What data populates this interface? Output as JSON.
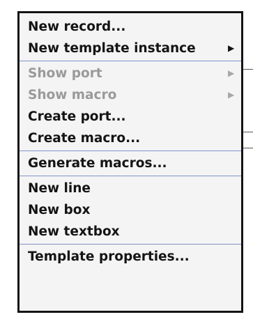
{
  "menu": {
    "items": [
      {
        "label": "New record...",
        "enabled": true
      },
      {
        "label": "New template instance",
        "enabled": true,
        "submenu": true,
        "arrow_icon": "submenu-arrow-icon"
      },
      {
        "label": "Show port",
        "enabled": false,
        "submenu": true,
        "arrow_icon": "submenu-arrow-icon"
      },
      {
        "label": "Show macro",
        "enabled": false,
        "submenu": true,
        "arrow_icon": "submenu-arrow-icon"
      },
      {
        "label": "Create port...",
        "enabled": true
      },
      {
        "label": "Create macro...",
        "enabled": true
      },
      {
        "label": "Generate macros...",
        "enabled": true
      },
      {
        "label": "New line",
        "enabled": true
      },
      {
        "label": "New box",
        "enabled": true
      },
      {
        "label": "New textbox",
        "enabled": true
      },
      {
        "label": "Template properties...",
        "enabled": true
      }
    ],
    "arrow_glyph": "▶",
    "colors": {
      "background": "#f4f4f4",
      "text": "#141414",
      "disabled_text": "#9a9a9a",
      "separator": "#7f95c9",
      "border": "#141414"
    }
  }
}
